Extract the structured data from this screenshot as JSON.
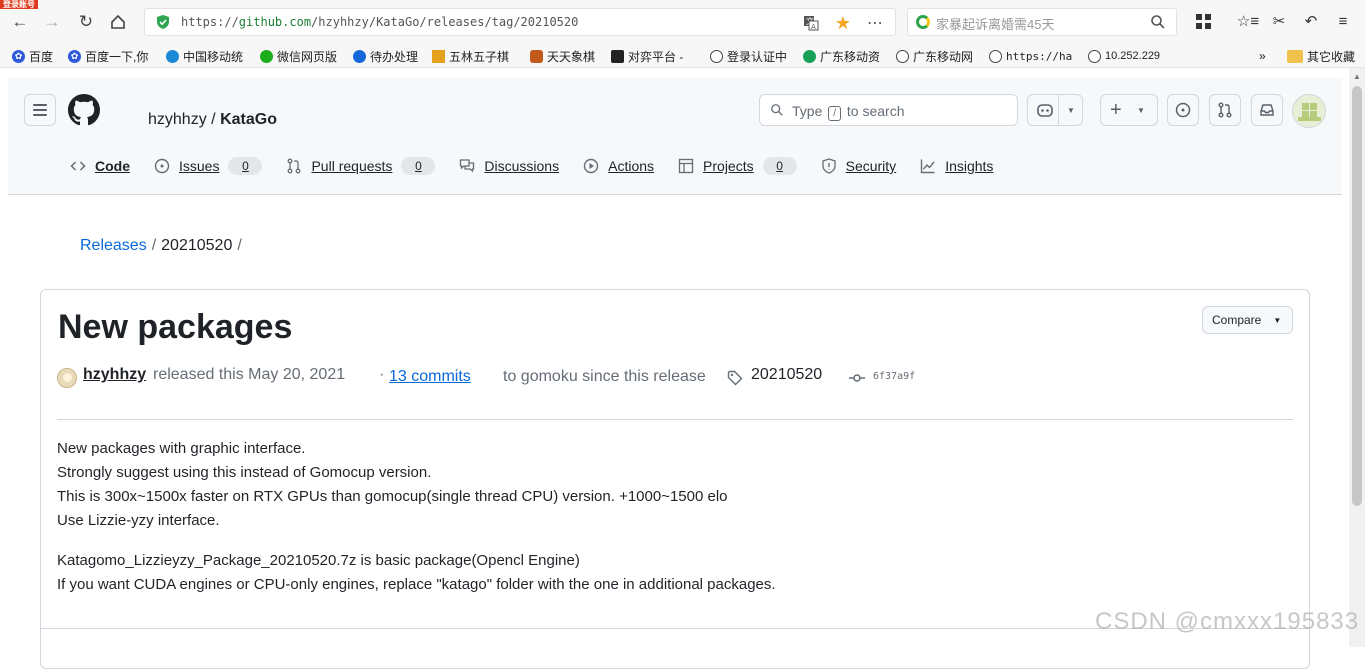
{
  "browser": {
    "login_badge": "登录账号",
    "url_scheme": "https://",
    "url_host": "github.com",
    "url_path": "/hzyhhzy/KataGo/releases/tag/20210520",
    "search_text": "家暴起诉离婚需45天",
    "bookmarks": [
      "百度",
      "百度一下,你",
      "中国移动统",
      "微信网页版",
      "待办处理",
      "五林五子棋",
      "天天象棋",
      "对弈平台 -",
      "登录认证中",
      "广东移动资",
      "广东移动网",
      "https://ha",
      "10.252.229",
      "»",
      "其它收藏"
    ]
  },
  "github": {
    "owner": "hzyhhzy",
    "separator": "/",
    "repo": "KataGo",
    "search_before": "Type",
    "search_key": "/",
    "search_after": "to search",
    "tabs": [
      {
        "label": "Code",
        "icon": "code-icon"
      },
      {
        "label": "Issues",
        "icon": "issue-icon",
        "count": "0"
      },
      {
        "label": "Pull requests",
        "icon": "pull-request-icon",
        "count": "0"
      },
      {
        "label": "Discussions",
        "icon": "discussion-icon"
      },
      {
        "label": "Actions",
        "icon": "play-icon"
      },
      {
        "label": "Projects",
        "icon": "table-icon",
        "count": "0"
      },
      {
        "label": "Security",
        "icon": "shield-icon"
      },
      {
        "label": "Insights",
        "icon": "graph-icon"
      }
    ]
  },
  "breadcrumb": {
    "link": "Releases",
    "separator": "/",
    "current": "20210520",
    "trailing": "/"
  },
  "release": {
    "title": "New packages",
    "compare_label": "Compare",
    "author": "hzyhhzy",
    "released_text": "released this May 20, 2021",
    "dot": "·",
    "commits_link": "13 commits",
    "since_text": "to gomoku since this release",
    "tag": "20210520",
    "sha": "6f37a9f",
    "body": [
      [
        "New packages with graphic interface.",
        "Strongly suggest using this instead of Gomocup version.",
        "This is 300x~1500x faster on RTX GPUs than gomocup(single thread CPU) version. +1000~1500 elo",
        "Use Lizzie-yzy interface."
      ],
      [
        "Katagomo_Lizzieyzy_Package_20210520.7z is basic package(Opencl Engine)",
        "If you want CUDA engines or CPU-only engines, replace \"katago\" folder with the one in additional packages."
      ]
    ]
  },
  "watermark": "CSDN @cmxxx195833",
  "colors": {
    "link": "#0969da",
    "text": "#1f2328",
    "muted": "#656d76",
    "border": "#d0d7de",
    "header_bg": "#f6f8fa"
  }
}
